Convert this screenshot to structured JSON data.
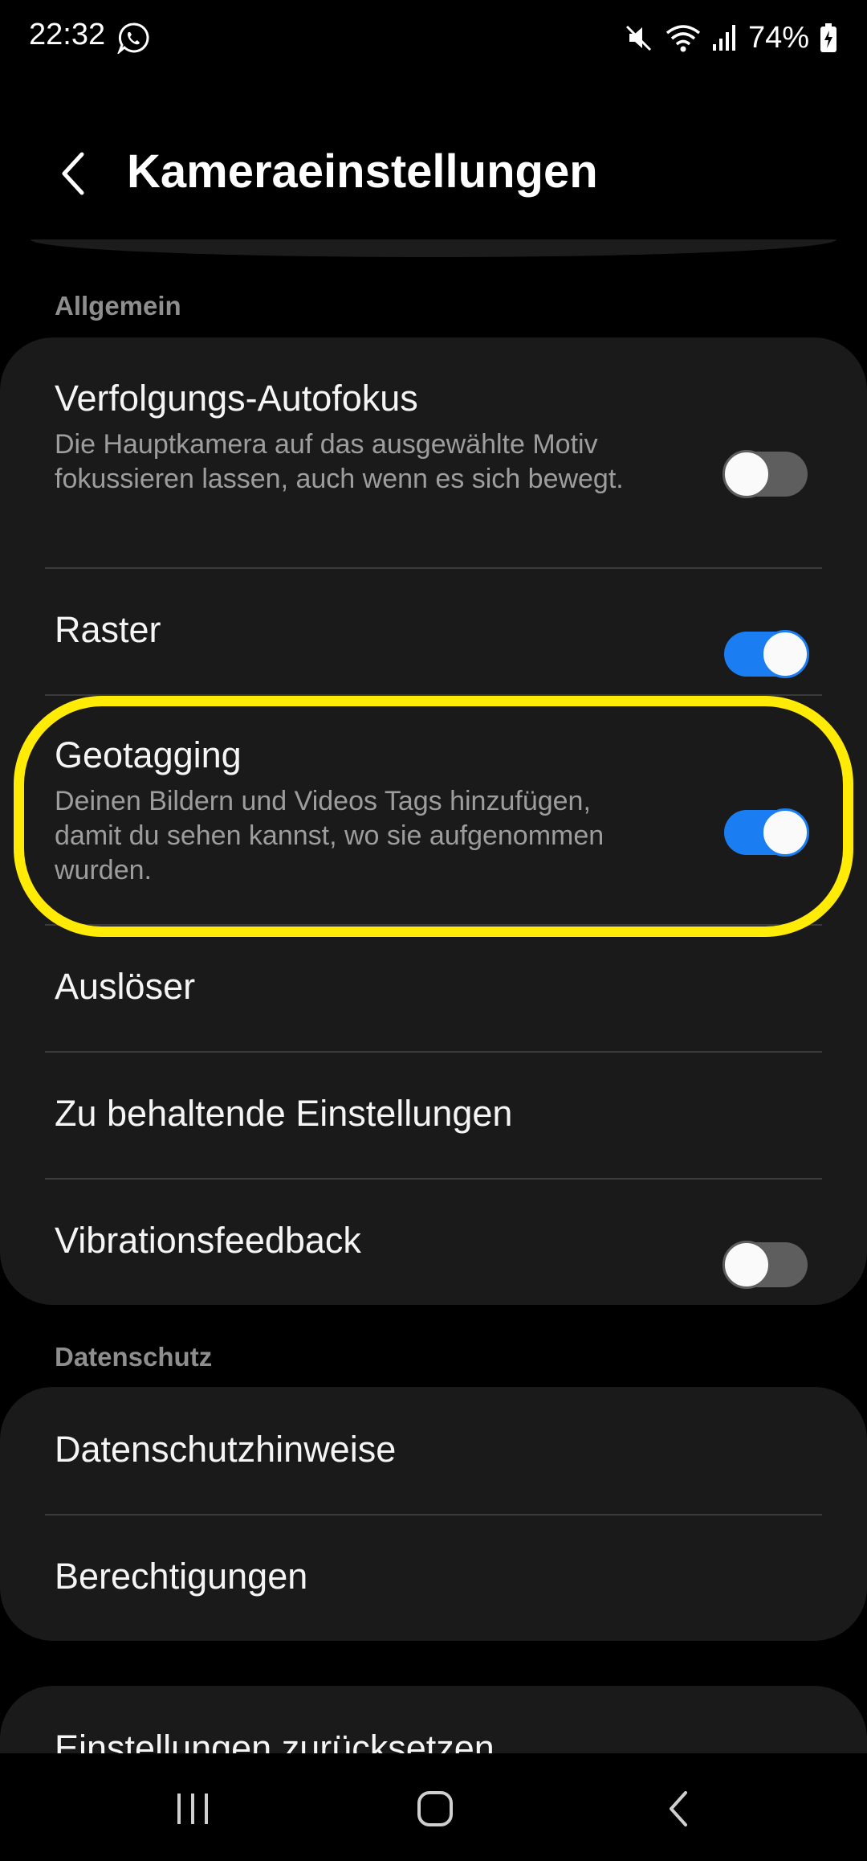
{
  "status_bar": {
    "time": "22:32",
    "battery": "74%"
  },
  "header": {
    "title": "Kameraeinstellungen"
  },
  "sections": {
    "general": {
      "label": "Allgemein",
      "items": [
        {
          "title": "Verfolgungs-Autofokus",
          "description": "Die Hauptkamera auf das ausgewählte Motiv fokussieren lassen, auch wenn es sich bewegt.",
          "toggle": "off"
        },
        {
          "title": "Raster",
          "toggle": "on"
        },
        {
          "title": "Geotagging",
          "description": "Deinen Bildern und Videos Tags hinzufügen, damit du sehen kannst, wo sie aufgenommen wurden.",
          "toggle": "on"
        },
        {
          "title": "Auslöser"
        },
        {
          "title": "Zu behaltende Einstellungen"
        },
        {
          "title": "Vibrationsfeedback",
          "toggle": "off"
        }
      ]
    },
    "privacy": {
      "label": "Datenschutz",
      "items": [
        {
          "title": "Datenschutzhinweise"
        },
        {
          "title": "Berechtigungen"
        }
      ]
    },
    "reset": {
      "items": [
        {
          "title": "Einstellungen zurücksetzen"
        }
      ]
    }
  },
  "colors": {
    "accent": "#1a7ef2",
    "highlight": "#ffeb05",
    "card": "#1a1a1a",
    "background": "#000000"
  },
  "icons": [
    "whatsapp-icon",
    "mute-icon",
    "wifi-icon",
    "signal-icon",
    "battery-icon",
    "back-arrow-icon",
    "recents-icon",
    "home-icon",
    "nav-back-icon"
  ]
}
